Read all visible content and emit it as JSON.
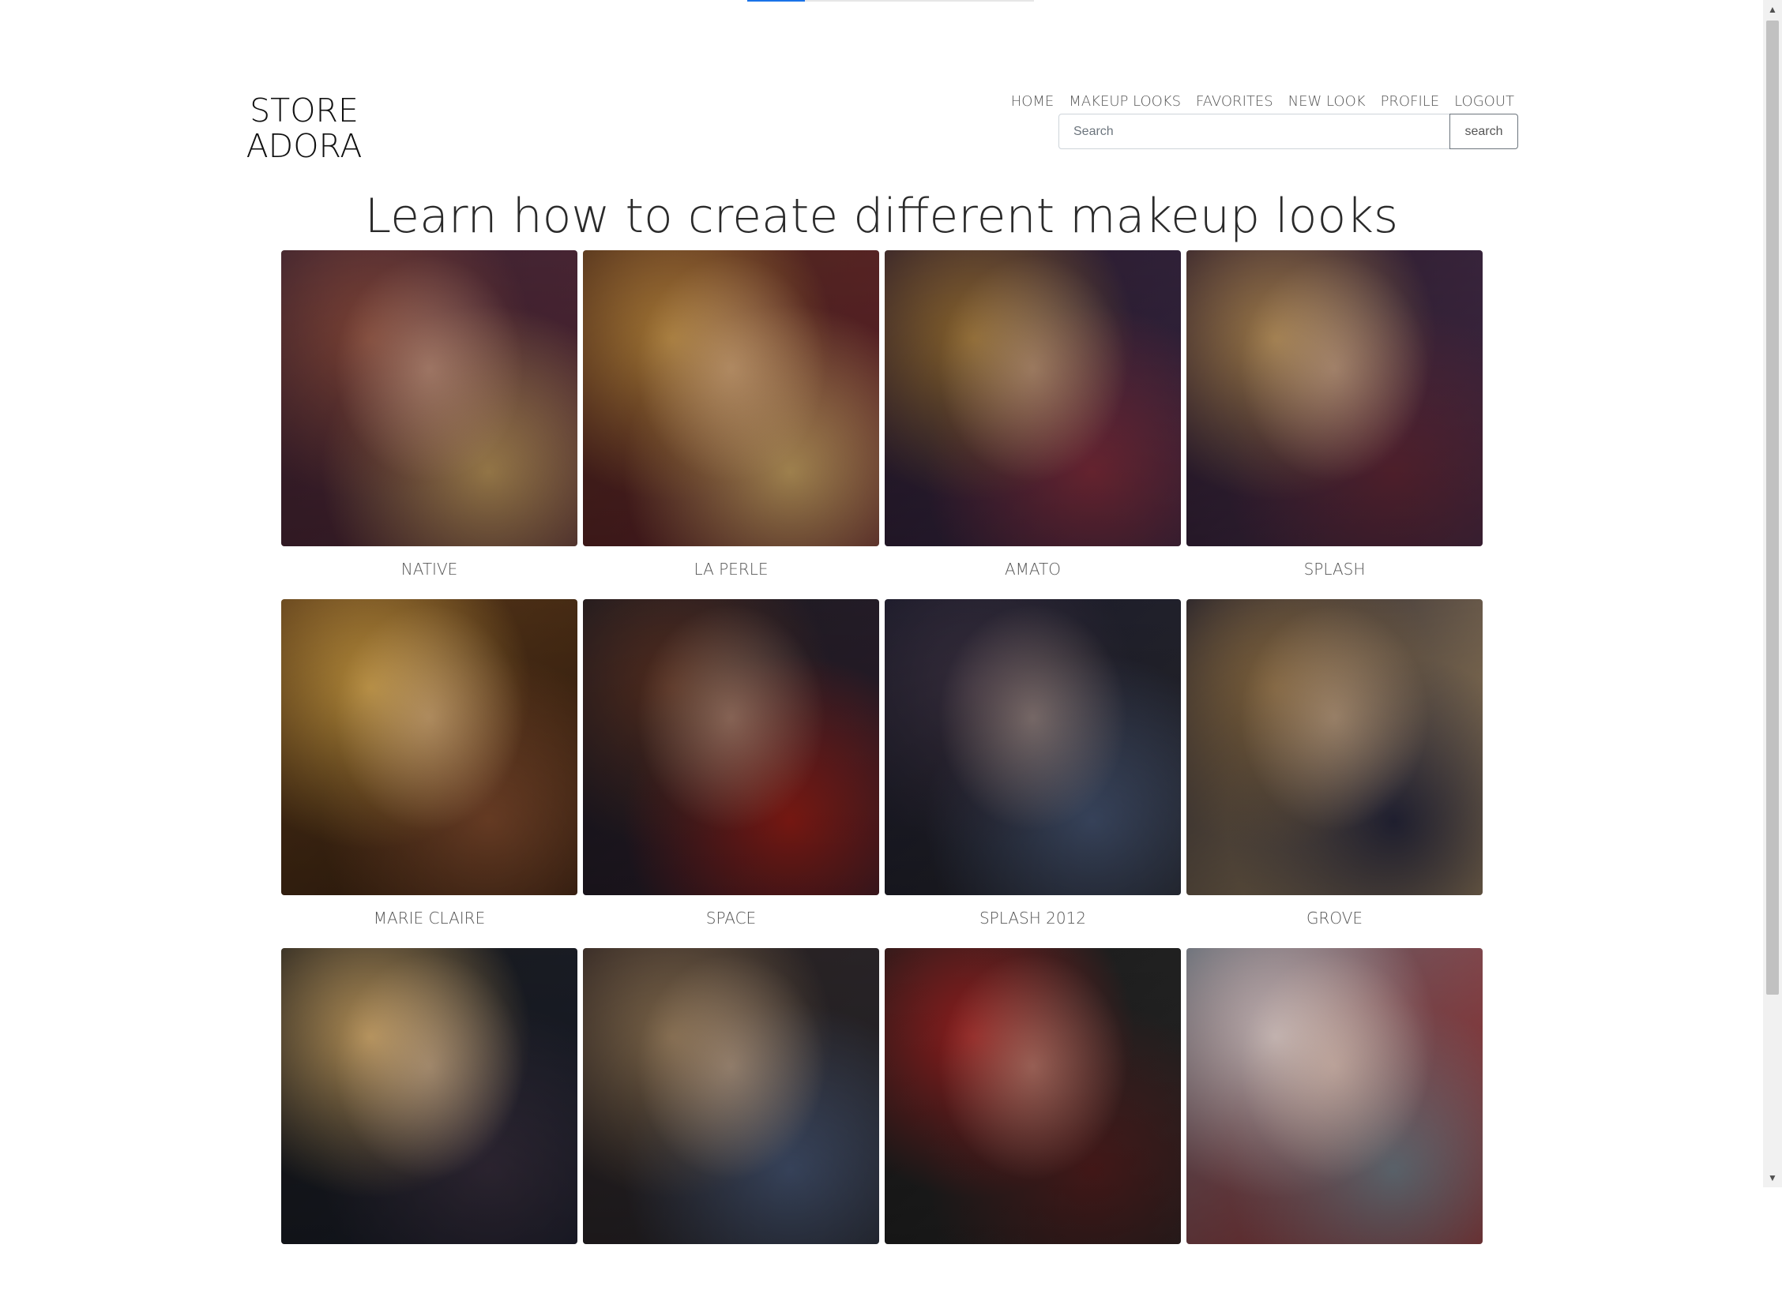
{
  "page": {
    "brand_line1": "STORE",
    "brand_line2": "ADORA",
    "title": "Learn how to create different makeup looks",
    "loading_progress": 0.2
  },
  "nav": {
    "items": [
      {
        "label": "HOME"
      },
      {
        "label": "MAKEUP LOOKS"
      },
      {
        "label": "FAVORITES"
      },
      {
        "label": "NEW LOOK"
      },
      {
        "label": "PROFILE"
      },
      {
        "label": "LOGOUT"
      }
    ]
  },
  "search": {
    "placeholder": "Search",
    "value": "",
    "button_label": "search"
  },
  "looks": [
    {
      "label": "NATIVE",
      "colors": [
        "#3a2230",
        "#8a4a3a",
        "#c9a060",
        "#5a2a3a"
      ]
    },
    {
      "label": "LA PERLE",
      "colors": [
        "#4a2a1a",
        "#b8863a",
        "#d9b06a",
        "#6a2030"
      ]
    },
    {
      "label": "AMATO",
      "colors": [
        "#2a1a2a",
        "#9a7030",
        "#8a3040",
        "#3a2a4a"
      ]
    },
    {
      "label": "SPLASH",
      "colors": [
        "#2a1a2a",
        "#b08850",
        "#6a2a3a",
        "#4a3050"
      ]
    },
    {
      "label": "MARIE CLAIRE",
      "colors": [
        "#5a3a1a",
        "#c99a40",
        "#8a5030",
        "#3a2010"
      ]
    },
    {
      "label": "SPACE",
      "colors": [
        "#1a1a20",
        "#5a3020",
        "#a02018",
        "#302030"
      ]
    },
    {
      "label": "SPLASH 2012",
      "colors": [
        "#1a1a2a",
        "#3a3040",
        "#4a5a7a",
        "#2a2a30"
      ]
    },
    {
      "label": "GROVE",
      "colors": [
        "#1a1a2a",
        "#8a6a40",
        "#2a2a40",
        "#c0a070"
      ]
    },
    {
      "label": "",
      "colors": [
        "#1a1a1a",
        "#c8a060",
        "#3a3040",
        "#1a2030"
      ]
    },
    {
      "label": "",
      "colors": [
        "#2a2020",
        "#8a7050",
        "#4a5a7a",
        "#2a2a30"
      ]
    },
    {
      "label": "",
      "colors": [
        "#1a1a1a",
        "#a02020",
        "#5a2020",
        "#2a2a2a"
      ]
    },
    {
      "label": "",
      "colors": [
        "#5a6570",
        "#d8c8c8",
        "#7a8590",
        "#b03030"
      ]
    }
  ]
}
